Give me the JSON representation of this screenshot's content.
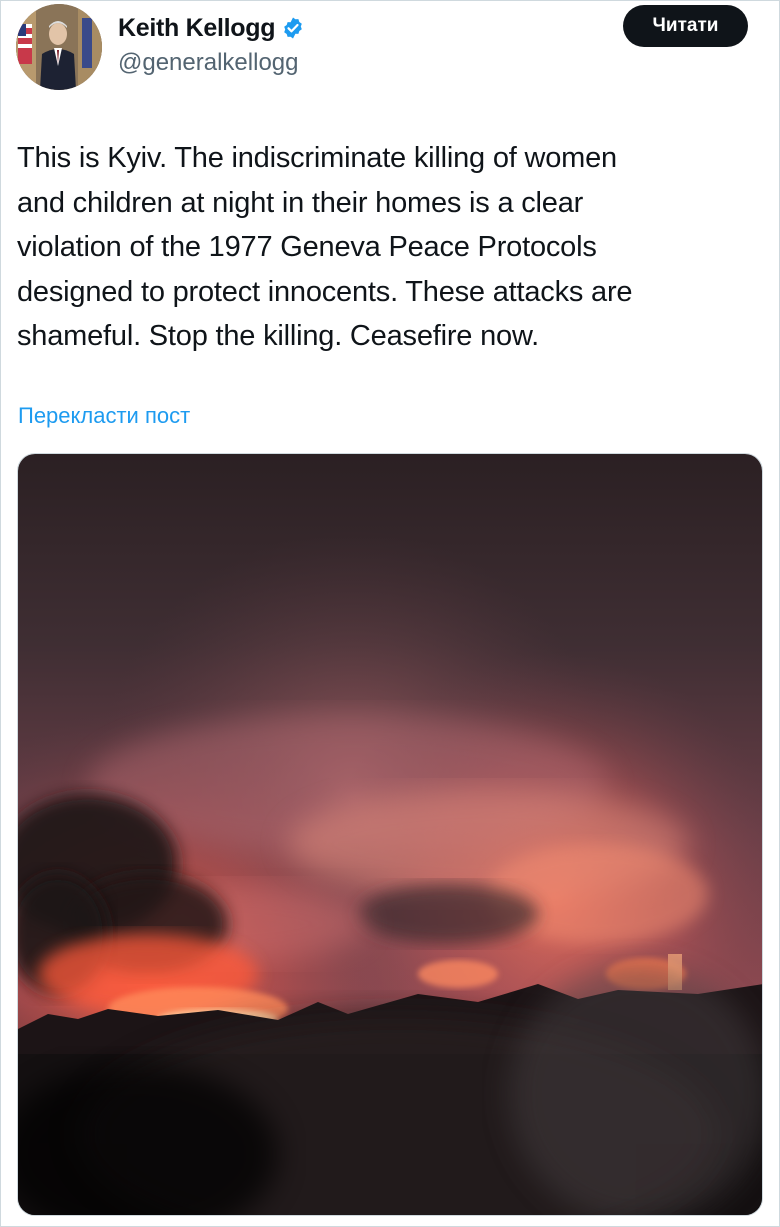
{
  "author": {
    "name": "Keith Kellogg",
    "handle": "@generalkellogg",
    "verified_icon": "verified-badge-icon",
    "verified_color": "#1d9bf0"
  },
  "actions": {
    "follow_label": "Читати"
  },
  "tweet": {
    "lines": [
      "This is Kyiv. The indiscriminate killing of women",
      "and children at night in their homes is a clear",
      "violation of the 1977 Geneva Peace Protocols",
      "designed to protect innocents. These attacks are",
      "shameful. Stop the killing. Ceasefire now."
    ],
    "translate_label": "Перекласти пост"
  },
  "colors": {
    "text": "#0f1419",
    "secondary": "#536471",
    "link": "#1d9bf0",
    "button_bg": "#0f1419"
  }
}
